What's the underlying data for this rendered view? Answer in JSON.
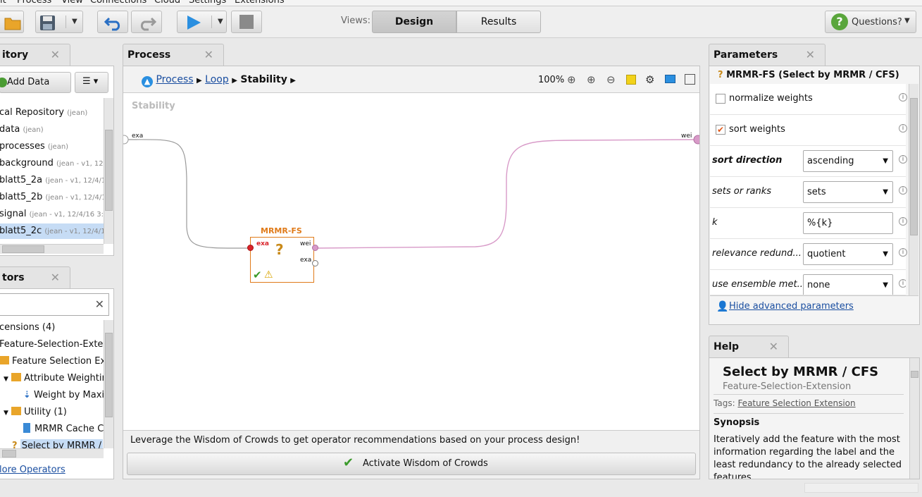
{
  "menu": {
    "items": [
      "it",
      "Process",
      "View",
      "Connections",
      "Cloud",
      "Settings",
      "Extensions"
    ]
  },
  "toolbar": {
    "views_label": "Views:",
    "design_tab": "Design",
    "results_tab": "Results",
    "questions_label": "Questions?"
  },
  "repository": {
    "tab_title": "itory",
    "add_data_label": "Add Data",
    "items": [
      {
        "name": "cal Repository",
        "meta": "(jean)"
      },
      {
        "name": "data",
        "meta": "(jean)"
      },
      {
        "name": "processes",
        "meta": "(jean)"
      },
      {
        "name": "background",
        "meta": "(jean - v1, 12"
      },
      {
        "name": "blatt5_2a",
        "meta": "(jean - v1, 12/4/1"
      },
      {
        "name": "blatt5_2b",
        "meta": "(jean - v1, 12/4/1"
      },
      {
        "name": "signal",
        "meta": "(jean - v1, 12/4/16 3:"
      },
      {
        "name": "blatt5_2c",
        "meta": "(jean - v1, 12/4/1"
      }
    ]
  },
  "operators": {
    "tab_title": "tors",
    "tree": [
      "censions (4)",
      "Feature-Selection-Exter",
      "Feature Selection Ex",
      "Attribute Weightir",
      "Weight by Maxi",
      "Utility (1)",
      "MRMR Cache Cr",
      "Select by MRMR /"
    ],
    "more_link": "lore Operators"
  },
  "process": {
    "tab_title": "Process",
    "breadcrumb": {
      "root": "Process",
      "loop": "Loop",
      "current": "Stability"
    },
    "zoom": "100%",
    "canvas_title": "Stability",
    "port_in_label": "exa",
    "port_out_label": "wei",
    "operator": {
      "name": "MRMR-FS",
      "port_in": "exa",
      "port_out_1": "wei",
      "port_out_2": "exa"
    },
    "wisdom_text": "Leverage the Wisdom of Crowds to get operator recommendations based on your process design!",
    "wisdom_button": "Activate Wisdom of Crowds"
  },
  "parameters": {
    "tab_title": "Parameters",
    "operator_title": "MRMR-FS (Select by MRMR / CFS)",
    "normalize_label": "normalize weights",
    "normalize_checked": false,
    "sort_label": "sort weights",
    "sort_checked": true,
    "rows": [
      {
        "label": "sort direction",
        "value": "ascending",
        "type": "select"
      },
      {
        "label": "sets or ranks",
        "value": "sets",
        "type": "select"
      },
      {
        "label": "k",
        "value": "%{k}",
        "type": "text"
      },
      {
        "label": "relevance redund...",
        "value": "quotient",
        "type": "select"
      },
      {
        "label": "use ensemble met...",
        "value": "none",
        "type": "select"
      }
    ],
    "hide_advanced": "Hide advanced parameters"
  },
  "help": {
    "tab_title": "Help",
    "title": "Select by MRMR / CFS",
    "subtitle": "Feature-Selection-Extension",
    "tags_label": "Tags:",
    "tags_link": "Feature Selection Extension",
    "synopsis_heading": "Synopsis",
    "synopsis_text": "Iteratively add the feature with the most information regarding the label and the least redundancy to the already selected features."
  },
  "colors": {
    "accent_orange": "#e07b1a",
    "link_blue": "#1a4ea0",
    "selection_blue": "#c6dcf5",
    "port_pink": "#d89ac8"
  }
}
